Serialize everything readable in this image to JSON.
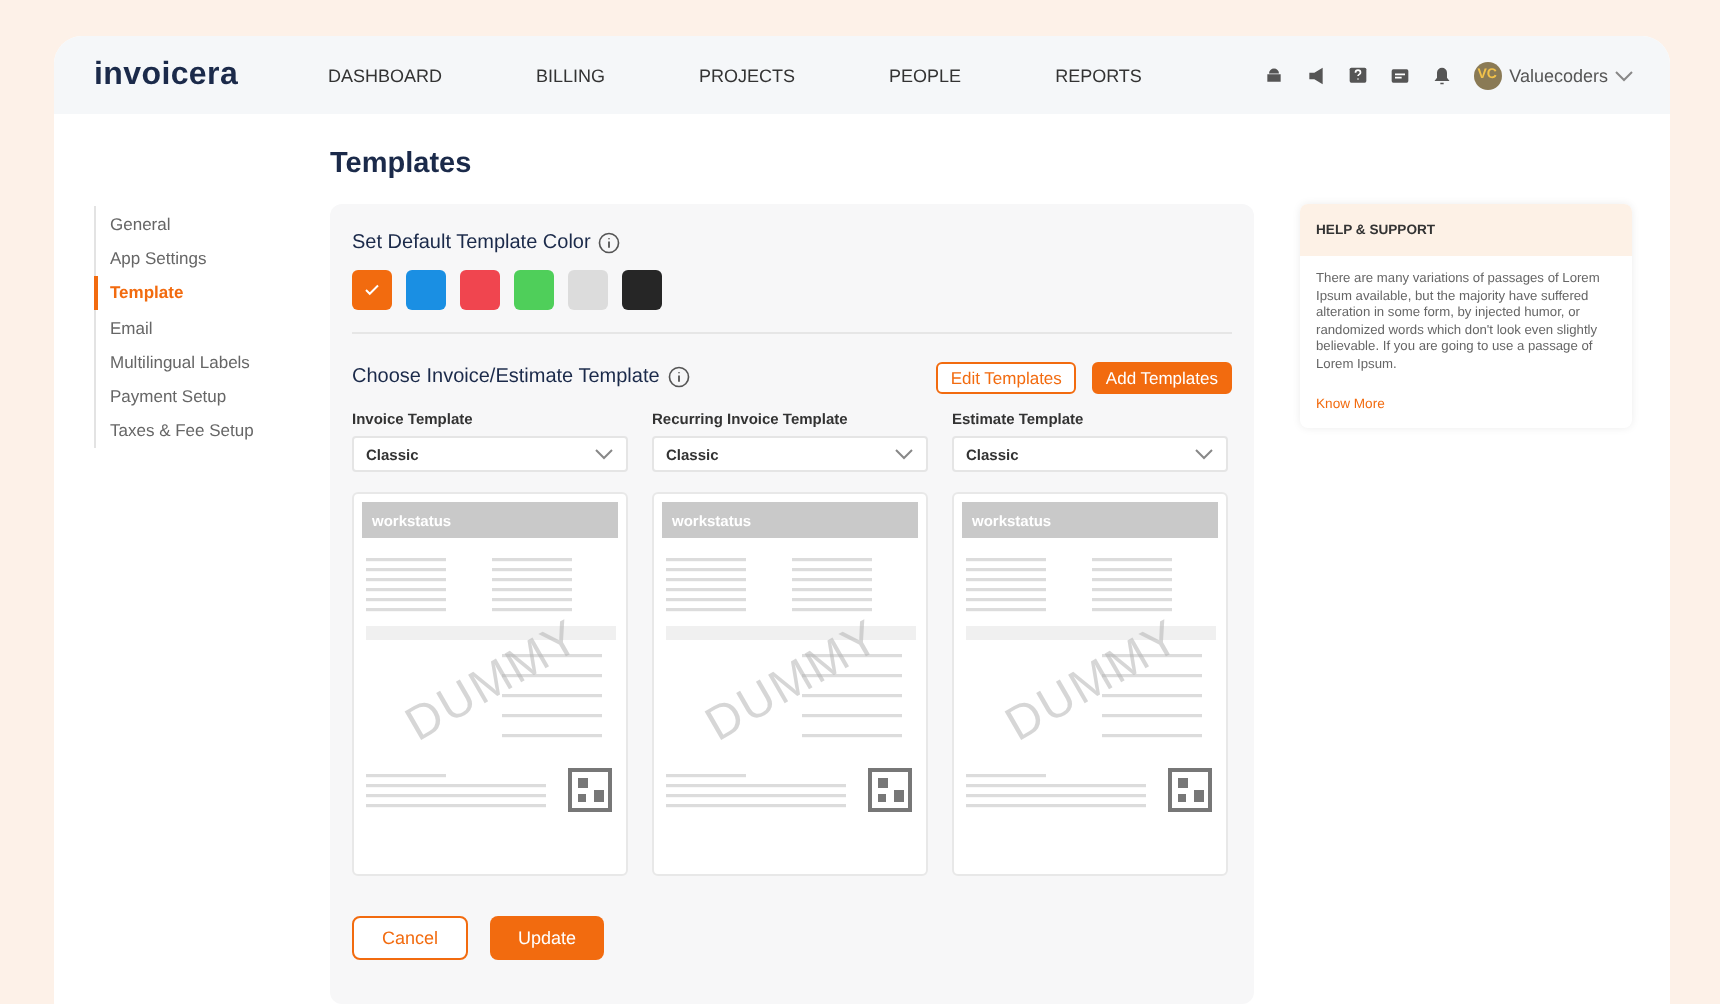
{
  "header": {
    "logo": "invoicera",
    "nav": [
      {
        "label": "DASHBOARD",
        "selected": false
      },
      {
        "label": "BILLING",
        "selected": false
      },
      {
        "label": "PROJECTS",
        "selected": false
      },
      {
        "label": "PEOPLE",
        "selected": false
      },
      {
        "label": "REPORTS",
        "selected": false
      }
    ],
    "avatar_initials": "VC",
    "user": "Valuecoders"
  },
  "page_title": "Templates",
  "sidebar": {
    "items": [
      {
        "label": "General",
        "selected": false
      },
      {
        "label": "App Settings",
        "selected": false
      },
      {
        "label": "Template",
        "selected": true
      },
      {
        "label": "Email",
        "selected": false
      },
      {
        "label": "Multilingual Labels",
        "selected": false
      },
      {
        "label": "Payment Setup",
        "selected": false
      },
      {
        "label": "Taxes & Fee Setup",
        "selected": false
      }
    ]
  },
  "color_section": {
    "title": "Set Default Template Color",
    "swatches": [
      {
        "color": "#f26b0f",
        "selected": true
      },
      {
        "color": "#1a8fe3",
        "selected": false
      },
      {
        "color": "#f0454f",
        "selected": false
      },
      {
        "color": "#4fcf5a",
        "selected": false
      },
      {
        "color": "#dcdcdc",
        "selected": false
      },
      {
        "color": "#262626",
        "selected": false
      }
    ]
  },
  "template_section": {
    "title": "Choose Invoice/Estimate Template",
    "edit_button": "Edit Templates",
    "add_button": "Add Templates",
    "templates": [
      {
        "label": "Invoice Template",
        "value": "Classic",
        "preview_logo": "workstatus",
        "watermark": "DUMMY"
      },
      {
        "label": "Recurring Invoice Template",
        "value": "Classic",
        "preview_logo": "workstatus",
        "watermark": "DUMMY"
      },
      {
        "label": "Estimate Template",
        "value": "Classic",
        "preview_logo": "workstatus",
        "watermark": "DUMMY"
      }
    ]
  },
  "actions": {
    "cancel": "Cancel",
    "update": "Update"
  },
  "help": {
    "title": "HELP & SUPPORT",
    "body": "There are many variations of passages of Lorem Ipsum available, but the majority have suffered alteration in some form, by injected humor, or randomized words which don't look even slightly believable. If you are going to use a passage of Lorem Ipsum.",
    "link": "Know More"
  }
}
